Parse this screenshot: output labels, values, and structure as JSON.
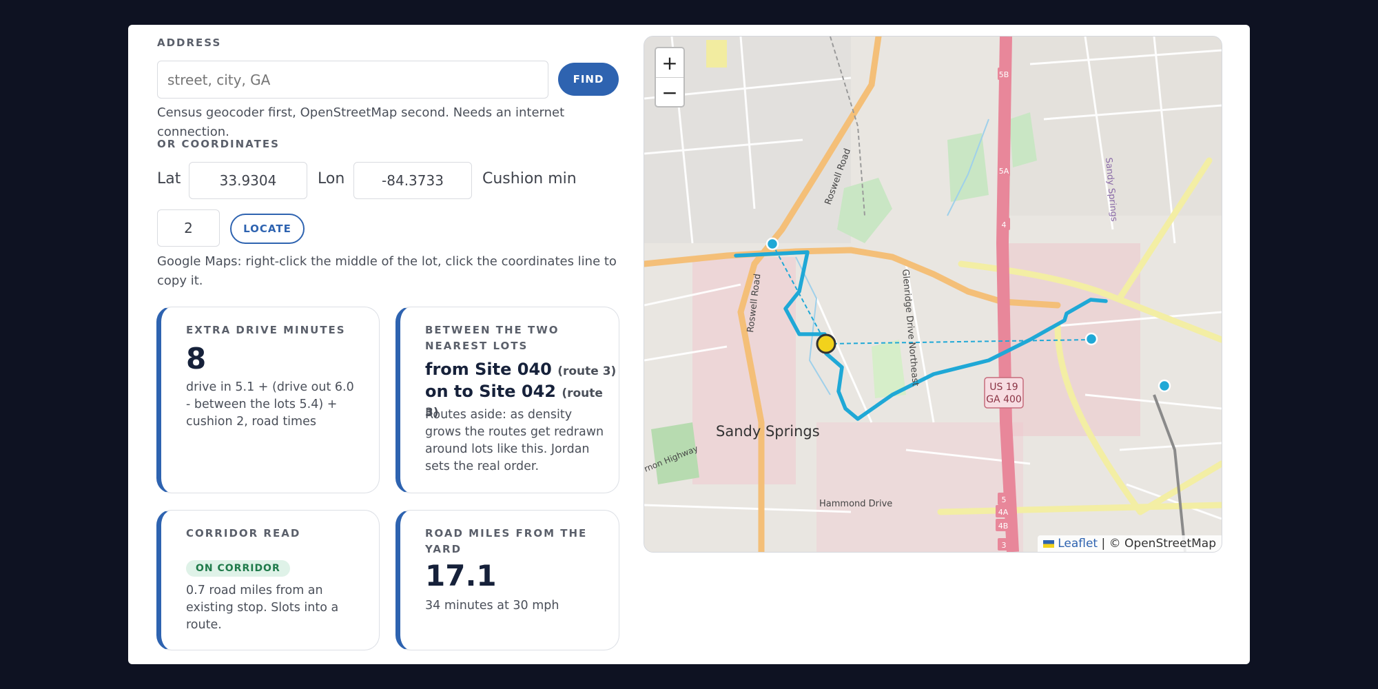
{
  "address": {
    "section_label": "ADDRESS",
    "placeholder": "street, city, GA",
    "find_label": "FIND",
    "help": "Census geocoder first, OpenStreetMap second. Needs an internet connection."
  },
  "coords": {
    "section_label": "OR COORDINATES",
    "lat_label": "Lat",
    "lat_value": "33.9304",
    "lon_label": "Lon",
    "lon_value": "-84.3733",
    "cushion_label": "Cushion min",
    "cushion_value": "2",
    "locate_label": "LOCATE",
    "help": "Google Maps: right-click the middle of the lot, click the coordinates line to copy it."
  },
  "cards": {
    "extra_drive": {
      "label": "EXTRA DRIVE MINUTES",
      "value": "8",
      "detail": "drive in 5.1 + (drive out 6.0 - between the lots 5.4) + cushion 2, road times"
    },
    "between": {
      "label": "BETWEEN THE TWO NEAREST LOTS",
      "from_site": "from Site 040",
      "from_route": "(route 3)",
      "to_site": "on to Site 042",
      "to_route": "(route 3)",
      "detail": "Routes aside: as density grows the routes get redrawn around lots like this. Jordan sets the real order."
    },
    "corridor": {
      "label": "CORRIDOR READ",
      "badge": "ON CORRIDOR",
      "detail": "0.7 road miles from an existing stop. Slots into a route."
    },
    "road_miles": {
      "label": "ROAD MILES FROM THE YARD",
      "value": "17.1",
      "detail": "34 minutes at 30 mph"
    }
  },
  "map": {
    "zoom_in": "+",
    "zoom_out": "−",
    "attribution_link": "Leaflet",
    "attribution_rest": "| © OpenStreetMap",
    "labels": {
      "city": "Sandy Springs",
      "roswell_road_north": "Roswell Road",
      "roswell_road_south": "Roswell Road",
      "glenridge": "Glenridge Drive Northeast",
      "hammond": "Hammond Drive",
      "sandy_springs_circle": "Sandy Springs",
      "vernon": "rnon Highway",
      "shield_line1": "US 19",
      "shield_line2": "GA 400",
      "exit_5b": "5B",
      "exit_5a": "5A",
      "exit_4": "4",
      "exit_5": "5",
      "exit_4a": "4A",
      "exit_4b": "4B",
      "exit_3": "3"
    },
    "colors": {
      "route": "#1fa8d6",
      "highway": "#e8879a",
      "primary_road": "#f5c27a",
      "secondary_road": "#f2f0a8",
      "site_marker": "#f2d21c"
    }
  }
}
